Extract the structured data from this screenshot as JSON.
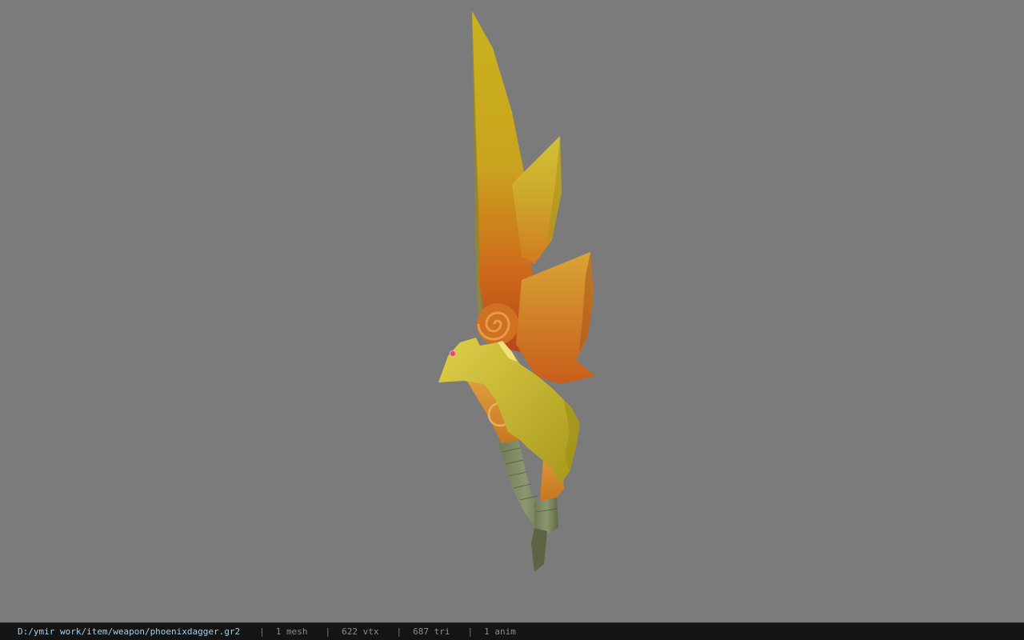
{
  "viewer": {
    "model_icon": "phoenix-dagger-model",
    "background_color": "#7b7b7b"
  },
  "status": {
    "file_path": "D:/ymir work/item/weapon/phoenixdagger.gr2",
    "separator": "|",
    "mesh": "1 mesh",
    "vertices": "622 vtx",
    "triangles": "687 tri",
    "animations": "1 anim",
    "path_color": "#9fd1f0"
  }
}
